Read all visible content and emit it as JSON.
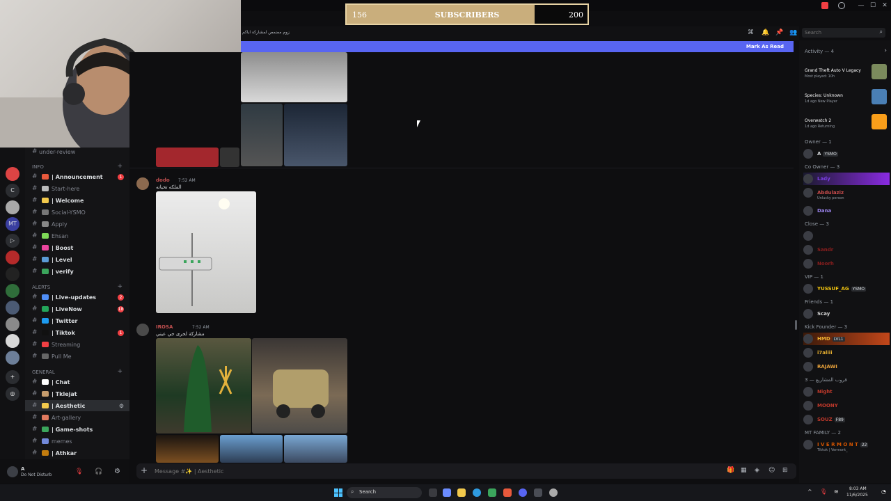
{
  "window": {
    "minimize": "—",
    "maximize": "☐",
    "close": "✕"
  },
  "stream_overlay": {
    "subscribers_current": "156",
    "subscribers_label": "SUBSCRIBERS",
    "subscribers_goal": "200",
    "progress_fraction": 0.78
  },
  "server_rail": {
    "items": [
      "C",
      "MT"
    ]
  },
  "channels": {
    "top_partial": "under-review",
    "categories": {
      "info": "INFO",
      "alerts": "ALERTS",
      "general": "GENERAL"
    },
    "items": [
      {
        "name": "| Announcement",
        "badge": "1",
        "muted": false,
        "color": "#e8593c"
      },
      {
        "name": "Start-here",
        "badge": "",
        "muted": true,
        "color": "#bbbbbb"
      },
      {
        "name": "| Welcome",
        "badge": "",
        "muted": false,
        "color": "#f2c94c"
      },
      {
        "name": "Social-YSMO",
        "badge": "",
        "muted": true,
        "color": "#777777"
      },
      {
        "name": "Apply",
        "badge": "",
        "muted": true,
        "color": "#888888"
      },
      {
        "name": "Ehsan",
        "badge": "",
        "muted": true,
        "color": "#7ed957"
      },
      {
        "name": "| Boost",
        "badge": "",
        "muted": false,
        "color": "#eb459e"
      },
      {
        "name": "| Level",
        "badge": "",
        "muted": false,
        "color": "#5b9bd5"
      },
      {
        "name": "| verify",
        "badge": "",
        "muted": false,
        "color": "#3ba55c"
      },
      {
        "name": "| Live-updates",
        "badge": "2",
        "muted": false,
        "color": "#4f8ef7"
      },
      {
        "name": "| LiveNow",
        "badge": "18",
        "muted": false,
        "color": "#23a55a"
      },
      {
        "name": "| Twitter",
        "badge": "",
        "muted": false,
        "color": "#1d9bf0"
      },
      {
        "name": "| Tiktok",
        "badge": "1",
        "muted": false,
        "color": "#111111"
      },
      {
        "name": "Streaming",
        "badge": "",
        "muted": true,
        "color": "#f23f43"
      },
      {
        "name": "Pull Me",
        "badge": "",
        "muted": true,
        "color": "#666666"
      },
      {
        "name": "| Chat",
        "badge": "",
        "muted": false,
        "color": "#ffffff"
      },
      {
        "name": "| Tklejat",
        "badge": "",
        "muted": false,
        "color": "#c69c6d"
      },
      {
        "name": "| Aesthetic",
        "badge": "",
        "muted": false,
        "color": "#f2c94c",
        "active": true
      },
      {
        "name": "Art-gallery",
        "badge": "",
        "muted": true,
        "color": "#e07a5f"
      },
      {
        "name": "| Game-shots",
        "badge": "",
        "muted": false,
        "color": "#3ba55c"
      },
      {
        "name": "memes",
        "badge": "",
        "muted": true,
        "color": "#7289da"
      },
      {
        "name": "| Athkar",
        "badge": "",
        "muted": false,
        "color": "#c27c0e"
      }
    ]
  },
  "user_panel": {
    "name": "A",
    "status": "Do Not Disturb"
  },
  "top_bar": {
    "channel_topic": "زوم مضمص لمشاركة اياكم",
    "search_placeholder": "Search"
  },
  "mark_as_read": "Mark As Read",
  "messages": [
    {
      "author": "dodo",
      "time": "7:52 AM",
      "text": "الملكه تحياته"
    },
    {
      "author": "IROSA",
      "time": "7:52 AM",
      "text": "مشاركة لحرى جي عيني"
    }
  ],
  "composer": {
    "placeholder": "Message #✨ | Aesthetic"
  },
  "members": {
    "activity_header": "Activity — 4",
    "activities": [
      {
        "game": "Grand Theft Auto V Legacy",
        "sub": "Most played: 10h",
        "color": "#7b8b5d"
      },
      {
        "game": "Species: Unknown",
        "sub": "1d ago  New Player",
        "color": "#4a7fb5"
      },
      {
        "game": "Overwatch 2",
        "sub": "1d ago  Returning",
        "color": "#f99e1a"
      }
    ],
    "groups": [
      {
        "header": "Owner — 1",
        "members": [
          {
            "name": "A",
            "tag": "YSMO",
            "color": "#dbdee1"
          }
        ]
      },
      {
        "header": "Co Owner — 3",
        "members": [
          {
            "name": "Lady",
            "tag": "",
            "color": "#7b3fe4"
          },
          {
            "name": "Abdulaziz",
            "tag": "",
            "color": "#c74b4b",
            "sub": "Unlucky person"
          },
          {
            "name": "Dana",
            "tag": "",
            "color": "#9b84ee"
          }
        ]
      },
      {
        "header": "Close — 3",
        "members": [
          {
            "name": "",
            "tag": "",
            "color": "#8b1e1e"
          },
          {
            "name": "Sandr",
            "tag": "",
            "color": "#8b1e1e"
          },
          {
            "name": "Noorh",
            "tag": "",
            "color": "#8b1e1e"
          }
        ]
      },
      {
        "header": "VIP — 1",
        "members": [
          {
            "name": "YUSSUF_AG",
            "tag": "YSMO",
            "color": "#f1c40f"
          }
        ]
      },
      {
        "header": "Friends — 1",
        "members": [
          {
            "name": "Scay",
            "tag": "",
            "color": "#d1d1d1"
          }
        ]
      },
      {
        "header": "Kick Founder — 3",
        "members": [
          {
            "name": "HMD",
            "tag": "LVL1",
            "color": "#f0b232"
          },
          {
            "name": "i7aliii",
            "tag": "",
            "color": "#e8b030"
          },
          {
            "name": "RAJAWI",
            "tag": "",
            "color": "#e9a23b"
          }
        ]
      },
      {
        "header": "قروب المشاريع — 3",
        "members": [
          {
            "name": "Night",
            "tag": "",
            "color": "#c0392b"
          },
          {
            "name": "MOONY",
            "tag": "",
            "color": "#c0392b"
          },
          {
            "name": "SOUZ",
            "tag": "F89",
            "color": "#c0392b"
          }
        ]
      },
      {
        "header": "MT FAMILY — 2",
        "members": [
          {
            "name": "I V E R M O N T",
            "tag": "22",
            "color": "#d35400",
            "sub": "Tiktok | Vermont_"
          }
        ]
      }
    ]
  },
  "taskbar": {
    "search": "Search",
    "time": "8:03 AM",
    "date": "11/6/2025"
  }
}
